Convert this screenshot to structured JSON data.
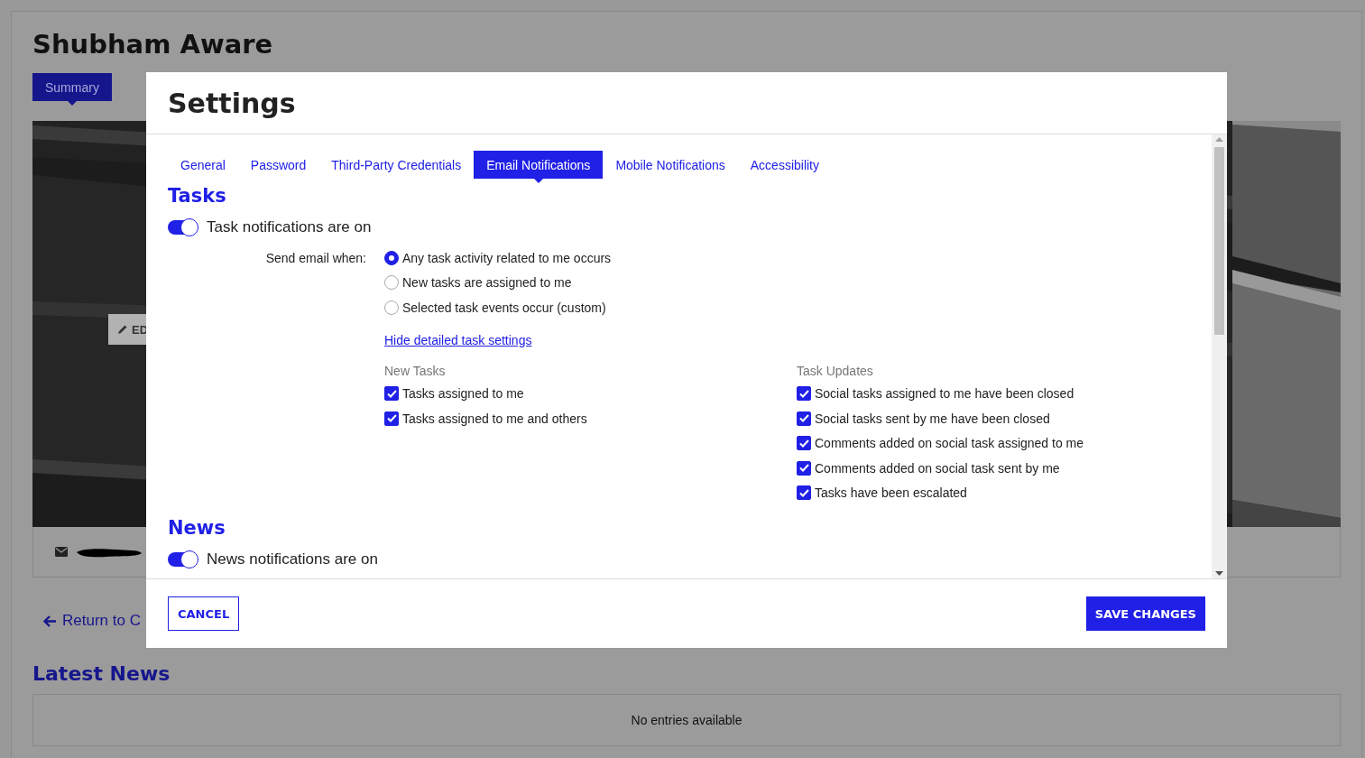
{
  "page": {
    "title": "Shubham Aware",
    "tabs": [
      {
        "label": "Summary",
        "selected": true
      }
    ],
    "edit_button": "ED",
    "return_link": "Return to C",
    "latest_news": {
      "title": "Latest News",
      "empty": "No entries available"
    }
  },
  "dialog": {
    "title": "Settings",
    "tabs": [
      {
        "label": "General",
        "selected": false
      },
      {
        "label": "Password",
        "selected": false
      },
      {
        "label": "Third-Party Credentials",
        "selected": false
      },
      {
        "label": "Email Notifications",
        "selected": true
      },
      {
        "label": "Mobile Notifications",
        "selected": false
      },
      {
        "label": "Accessibility",
        "selected": false
      }
    ],
    "sections": [
      {
        "title": "Tasks",
        "toggle": {
          "label": "Task notifications are on",
          "on": true
        },
        "send_when": {
          "label": "Send email when:",
          "options": [
            {
              "label": "Any task activity related to me occurs",
              "selected": true
            },
            {
              "label": "New tasks are assigned to me",
              "selected": false
            },
            {
              "label": "Selected task events occur (custom)",
              "selected": false
            }
          ]
        },
        "details_link": "Hide detailed task settings",
        "groups": [
          {
            "title": "New Tasks",
            "items": [
              {
                "label": "Tasks assigned to me",
                "checked": true
              },
              {
                "label": "Tasks assigned to me and others",
                "checked": true
              }
            ]
          },
          {
            "title": "Task Updates",
            "items": [
              {
                "label": "Social tasks assigned to me have been closed",
                "checked": true
              },
              {
                "label": "Social tasks sent by me have been closed",
                "checked": true
              },
              {
                "label": "Comments added on social task assigned to me",
                "checked": true
              },
              {
                "label": "Comments added on social task sent by me",
                "checked": true
              },
              {
                "label": "Tasks have been escalated",
                "checked": true
              }
            ]
          }
        ]
      },
      {
        "title": "News",
        "toggle": {
          "label": "News notifications are on",
          "on": true
        }
      }
    ],
    "buttons": {
      "cancel": "CANCEL",
      "save": "SAVE CHANGES"
    }
  }
}
